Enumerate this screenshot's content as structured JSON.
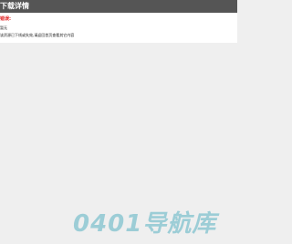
{
  "header": {
    "title": "下载详情"
  },
  "message": {
    "error_heading": "错误:",
    "line1": "暂无",
    "line2": "该资源已下线或失效,请返回首页查看其它内容"
  },
  "watermark": {
    "text": "0401导航库"
  },
  "colors": {
    "title_bar": "#555555",
    "error": "#e02020",
    "watermark": "#3aa6ba",
    "background": "#efefef"
  }
}
